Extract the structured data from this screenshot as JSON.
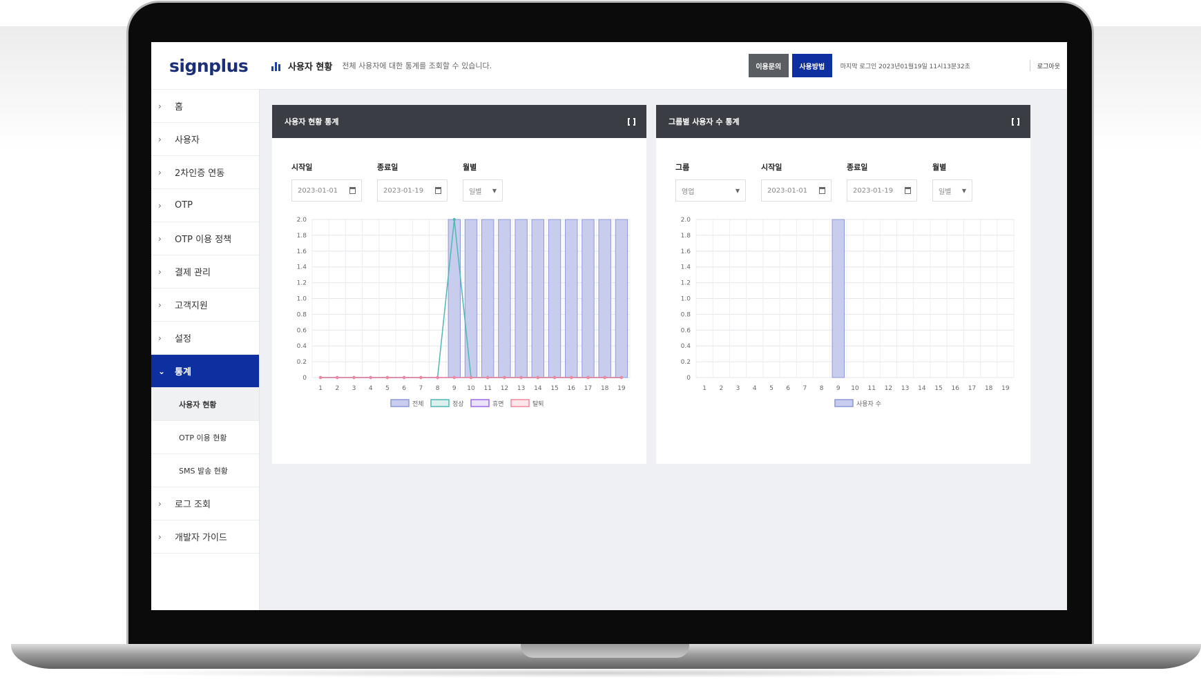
{
  "app": {
    "logo": "signplus"
  },
  "sidebar": {
    "items": [
      {
        "label": "홈",
        "chev": "›"
      },
      {
        "label": "사용자",
        "chev": "›"
      },
      {
        "label": "2차인증 연동",
        "chev": "›"
      },
      {
        "label": "OTP",
        "chev": "›"
      },
      {
        "label": "OTP 이용 정책",
        "chev": "›"
      },
      {
        "label": "결제 관리",
        "chev": "›"
      },
      {
        "label": "고객지원",
        "chev": "›"
      },
      {
        "label": "설정",
        "chev": "›"
      },
      {
        "label": "통계",
        "chev": "⌄"
      }
    ],
    "subitems": [
      "사용자 현황",
      "OTP 이용 현황",
      "SMS 발송 현황"
    ],
    "bottom_items": [
      {
        "label": "로그 조회",
        "chev": "›"
      },
      {
        "label": "개발자 가이드",
        "chev": "›"
      }
    ]
  },
  "topbar": {
    "title": "사용자 현황",
    "description": "전체 사용자에 대한 통계를 조회할 수 있습니다.",
    "inquiry_button": "이용문의",
    "guide_button": "사용방법",
    "last_login": "마지막 로그인 2023년01월19일 11시13분32초",
    "logout": "로그아웃"
  },
  "panel1": {
    "title": "사용자 현황 통계",
    "start_label": "시작일",
    "start_value": "2023-01-01",
    "end_label": "종료일",
    "end_value": "2023-01-19",
    "period_label": "월별",
    "period_value": "일별"
  },
  "panel2": {
    "title": "그룹별 사용자 수 통계",
    "group_label": "그룹",
    "group_value": "영업",
    "start_label": "시작일",
    "start_value": "2023-01-01",
    "end_label": "종료일",
    "end_value": "2023-01-19",
    "period_label": "월별",
    "period_value": "일별"
  },
  "chart_data": [
    {
      "type": "bar",
      "x": [
        1,
        2,
        3,
        4,
        5,
        6,
        7,
        8,
        9,
        10,
        11,
        12,
        13,
        14,
        15,
        16,
        17,
        18,
        19
      ],
      "ylim": [
        0,
        2.0
      ],
      "yticks": [
        "0",
        "0.2",
        "0.4",
        "0.6",
        "0.8",
        "1.0",
        "1.2",
        "1.4",
        "1.6",
        "1.8",
        "2.0"
      ],
      "grid": true,
      "legend_position": "bottom",
      "series": [
        {
          "name": "전체",
          "kind": "bar",
          "color": "#c8cdee",
          "values": [
            0,
            0,
            0,
            0,
            0,
            0,
            0,
            0,
            2,
            2,
            2,
            2,
            2,
            2,
            2,
            2,
            2,
            2,
            2
          ]
        },
        {
          "name": "정상",
          "kind": "line",
          "color": "#4fb8b0",
          "values": [
            0,
            0,
            0,
            0,
            0,
            0,
            0,
            0,
            2,
            0,
            0,
            0,
            0,
            0,
            0,
            0,
            0,
            0,
            0
          ]
        },
        {
          "name": "휴면",
          "kind": "line",
          "color": "#9a6be8",
          "values": [
            0,
            0,
            0,
            0,
            0,
            0,
            0,
            0,
            0,
            0,
            0,
            0,
            0,
            0,
            0,
            0,
            0,
            0,
            0
          ]
        },
        {
          "name": "탈퇴",
          "kind": "line",
          "color": "#f0889c",
          "values": [
            0,
            0,
            0,
            0,
            0,
            0,
            0,
            0,
            0,
            0,
            0,
            0,
            0,
            0,
            0,
            0,
            0,
            0,
            0
          ]
        }
      ]
    },
    {
      "type": "bar",
      "x": [
        1,
        2,
        3,
        4,
        5,
        6,
        7,
        8,
        9,
        10,
        11,
        12,
        13,
        14,
        15,
        16,
        17,
        18,
        19
      ],
      "ylim": [
        0,
        2.0
      ],
      "yticks": [
        "0",
        "0.2",
        "0.4",
        "0.6",
        "0.8",
        "1.0",
        "1.2",
        "1.4",
        "1.6",
        "1.8",
        "2.0"
      ],
      "grid": true,
      "legend_position": "bottom",
      "series": [
        {
          "name": "사용자 수",
          "kind": "bar",
          "color": "#c8cdee",
          "values": [
            0,
            0,
            0,
            0,
            0,
            0,
            0,
            0,
            2,
            0,
            0,
            0,
            0,
            0,
            0,
            0,
            0,
            0,
            0
          ]
        }
      ]
    }
  ]
}
